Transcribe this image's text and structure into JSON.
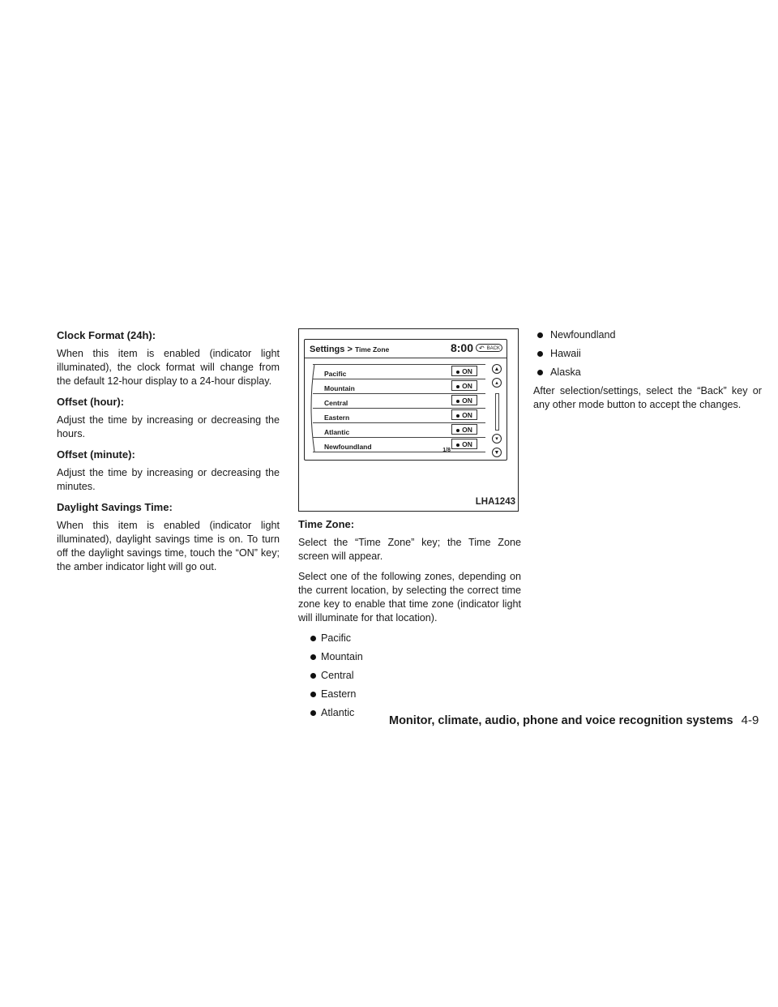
{
  "column1": {
    "sections": [
      {
        "heading": "Clock Format (24h):",
        "text": "When this item is enabled (indicator light illuminated), the clock format will change from the default 12-hour display to a 24-hour display."
      },
      {
        "heading": "Offset (hour):",
        "text": "Adjust the time by increasing or decreasing the hours."
      },
      {
        "heading": "Offset (minute):",
        "text": "Adjust the time by increasing or decreasing the minutes."
      },
      {
        "heading": "Daylight Savings Time:",
        "text": "When this item is enabled (indicator light illuminated), daylight savings time is on. To turn off the daylight savings time, touch the “ON” key; the amber indicator light will go out."
      }
    ]
  },
  "figure": {
    "breadcrumb_main": "Settings >",
    "breadcrumb_sub": "Time Zone",
    "clock": "8:00",
    "back_label": "BACK",
    "rows": [
      {
        "label": "Pacific",
        "state": "ON"
      },
      {
        "label": "Mountain",
        "state": "ON"
      },
      {
        "label": "Central",
        "state": "ON"
      },
      {
        "label": "Eastern",
        "state": "ON"
      },
      {
        "label": "Atlantic",
        "state": "ON"
      },
      {
        "label": "Newfoundland",
        "state": "ON"
      }
    ],
    "page_indicator": "1/8",
    "figure_id": "LHA1243"
  },
  "column2": {
    "heading": "Time Zone:",
    "para1": "Select the “Time Zone” key; the Time Zone screen will appear.",
    "para2": "Select one of the following zones, depending on the current location, by selecting the correct time zone key to enable that time zone (indicator light will illuminate for that location).",
    "bullets": [
      "Pacific",
      "Mountain",
      "Central",
      "Eastern",
      "Atlantic"
    ]
  },
  "column3": {
    "bullets": [
      "Newfoundland",
      "Hawaii",
      "Alaska"
    ],
    "para": "After selection/settings, select the “Back” key or any other mode button to accept the changes."
  },
  "footer": {
    "section_title": "Monitor, climate, audio, phone and voice recognition systems",
    "page_number": "4-9"
  }
}
